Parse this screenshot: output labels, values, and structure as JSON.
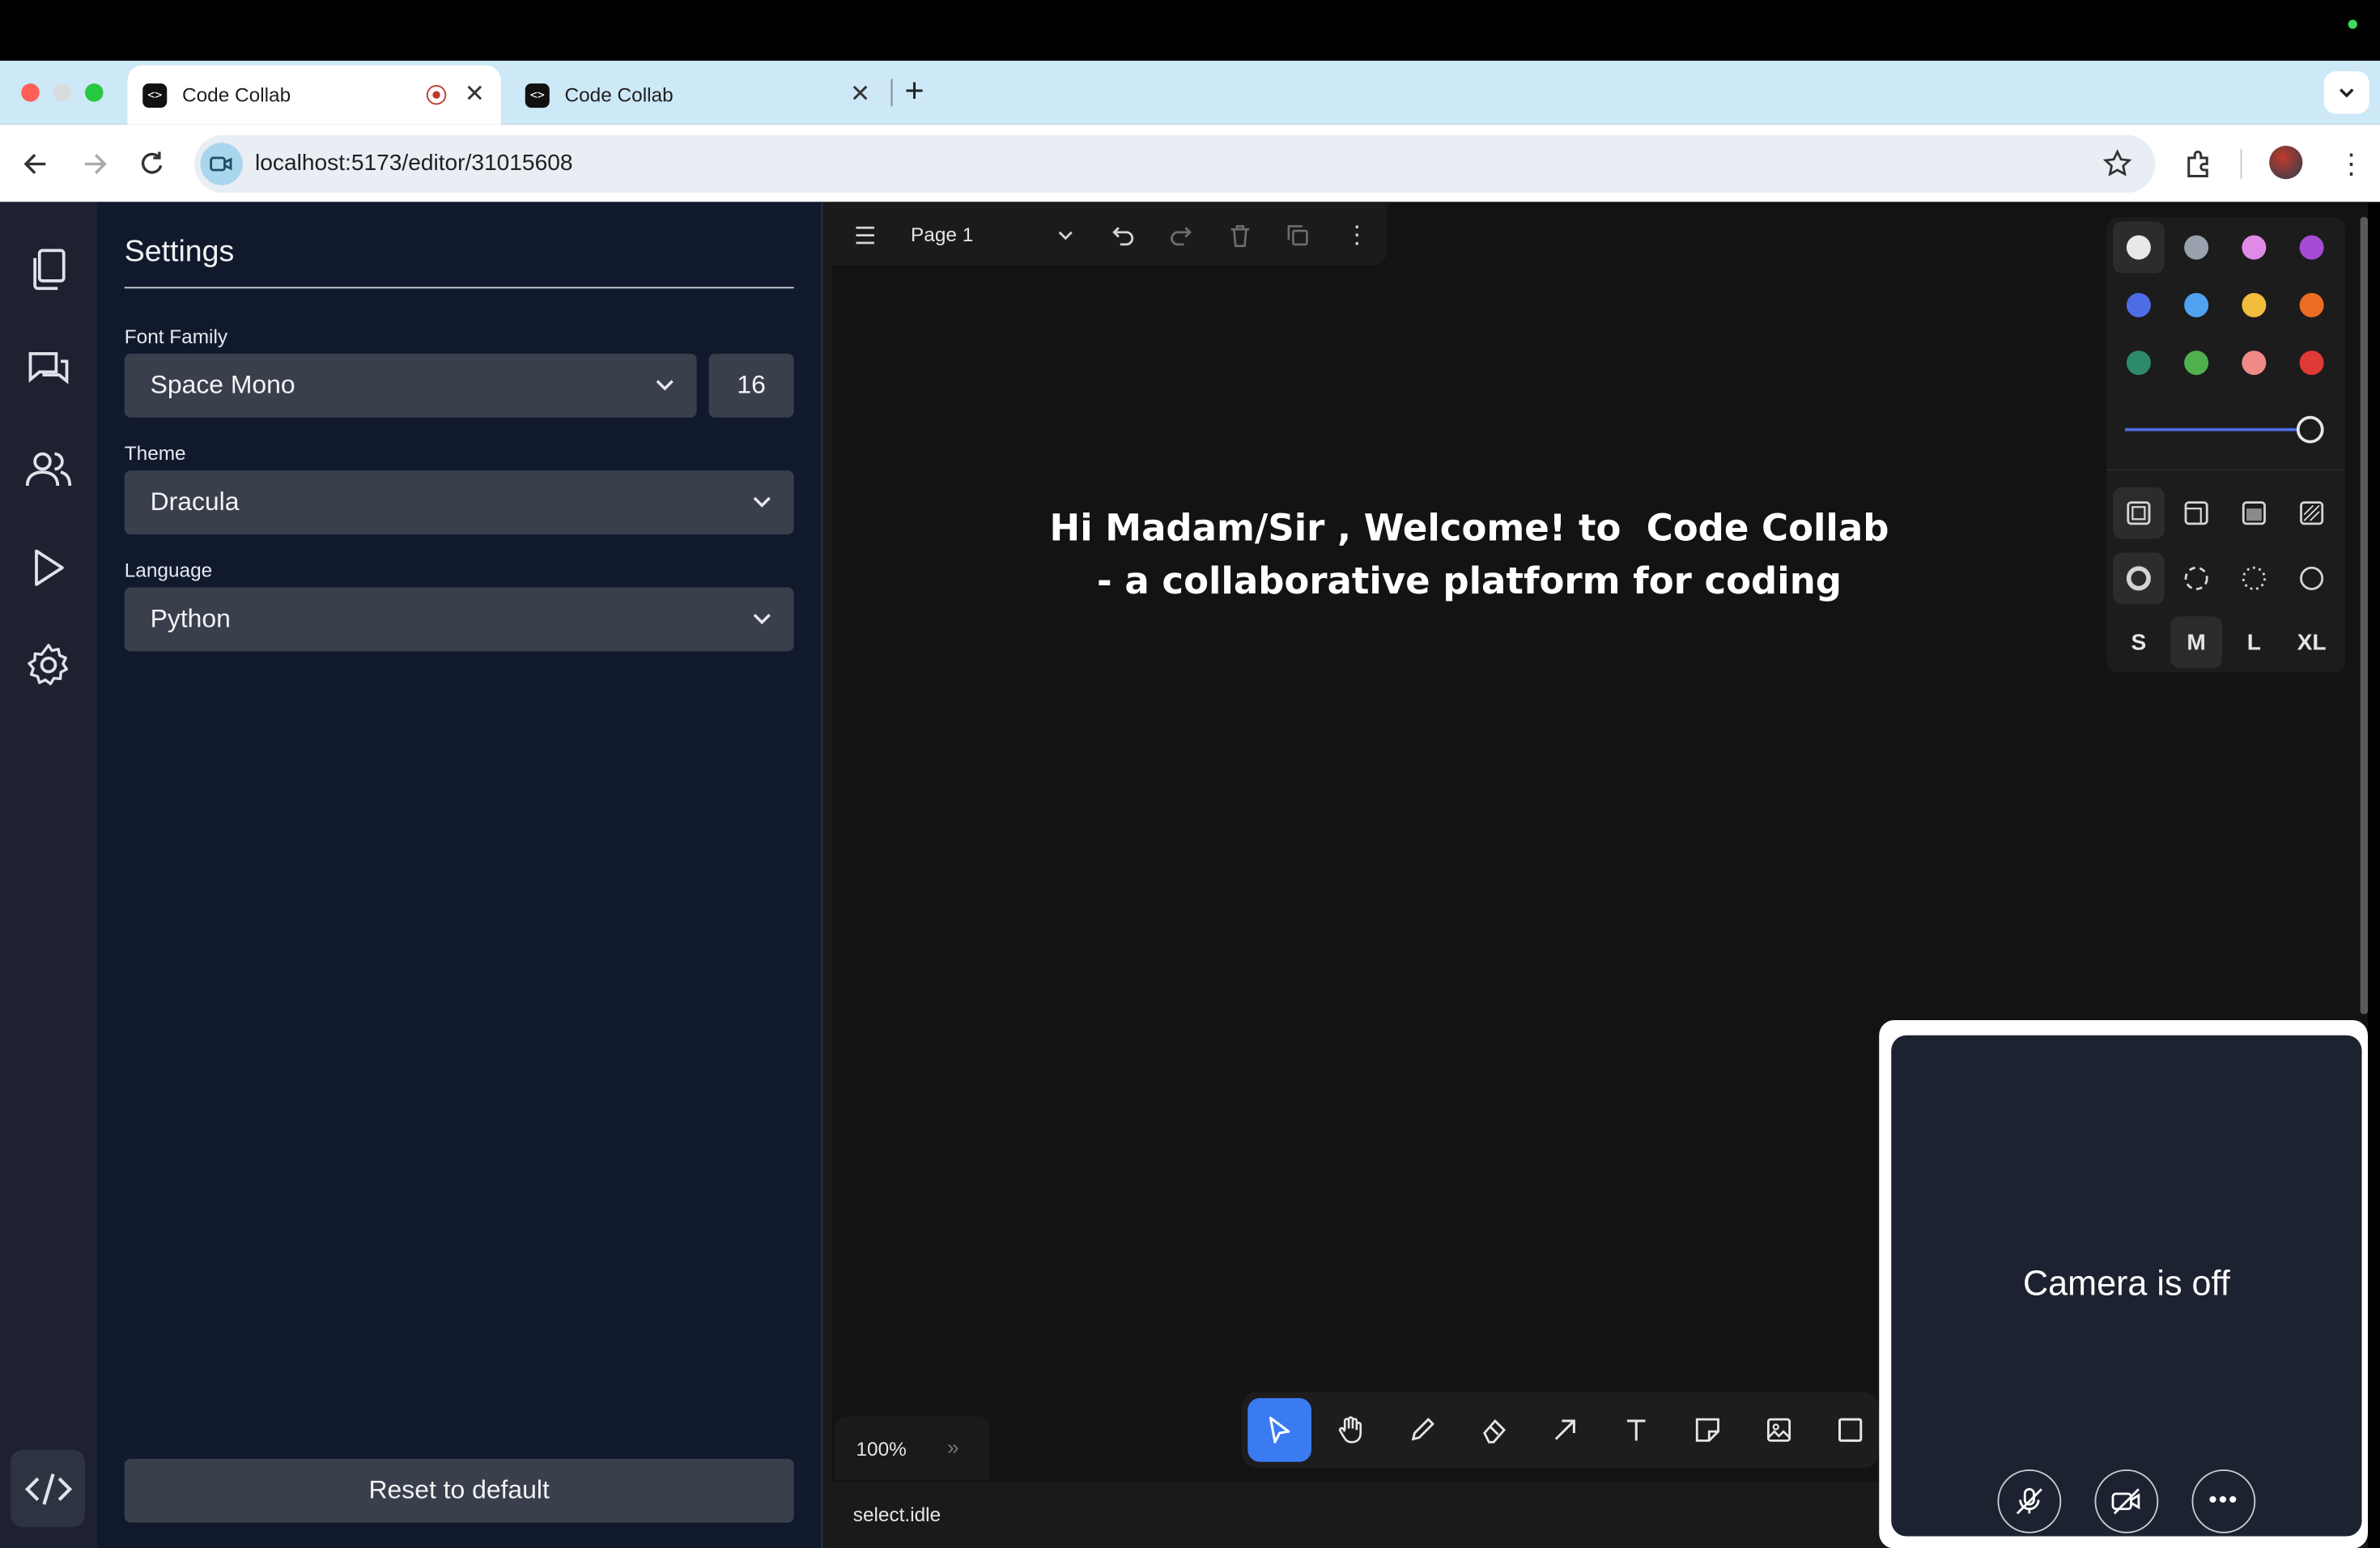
{
  "browser": {
    "tabs": [
      {
        "title": "Code Collab"
      },
      {
        "title": "Code Collab"
      }
    ],
    "url": "localhost:5173/editor/31015608"
  },
  "settings": {
    "title": "Settings",
    "font_family_label": "Font Family",
    "font_family_value": "Space Mono",
    "font_size_value": "16",
    "theme_label": "Theme",
    "theme_value": "Dracula",
    "language_label": "Language",
    "language_value": "Python",
    "reset_label": "Reset to default"
  },
  "whiteboard": {
    "page_name": "Page 1",
    "welcome_line1": "Hi Madam/Sir , Welcome! to  Code Collab",
    "welcome_line2": "- a collaborative platform for coding",
    "zoom": "100%",
    "status": "select.idle",
    "colors": [
      "#e8e8e8",
      "#9aa0ad",
      "#e08ae8",
      "#a64bd4",
      "#4d6ce6",
      "#4fa3f0",
      "#f2bc3c",
      "#ec6d22",
      "#2e8b6a",
      "#4fb04e",
      "#f08a86",
      "#e03a36"
    ],
    "opacity": 1,
    "sizes": [
      "S",
      "M",
      "L",
      "XL"
    ],
    "selected_size": "M",
    "selected_tool": "select"
  },
  "video": {
    "status": "Camera is off"
  }
}
